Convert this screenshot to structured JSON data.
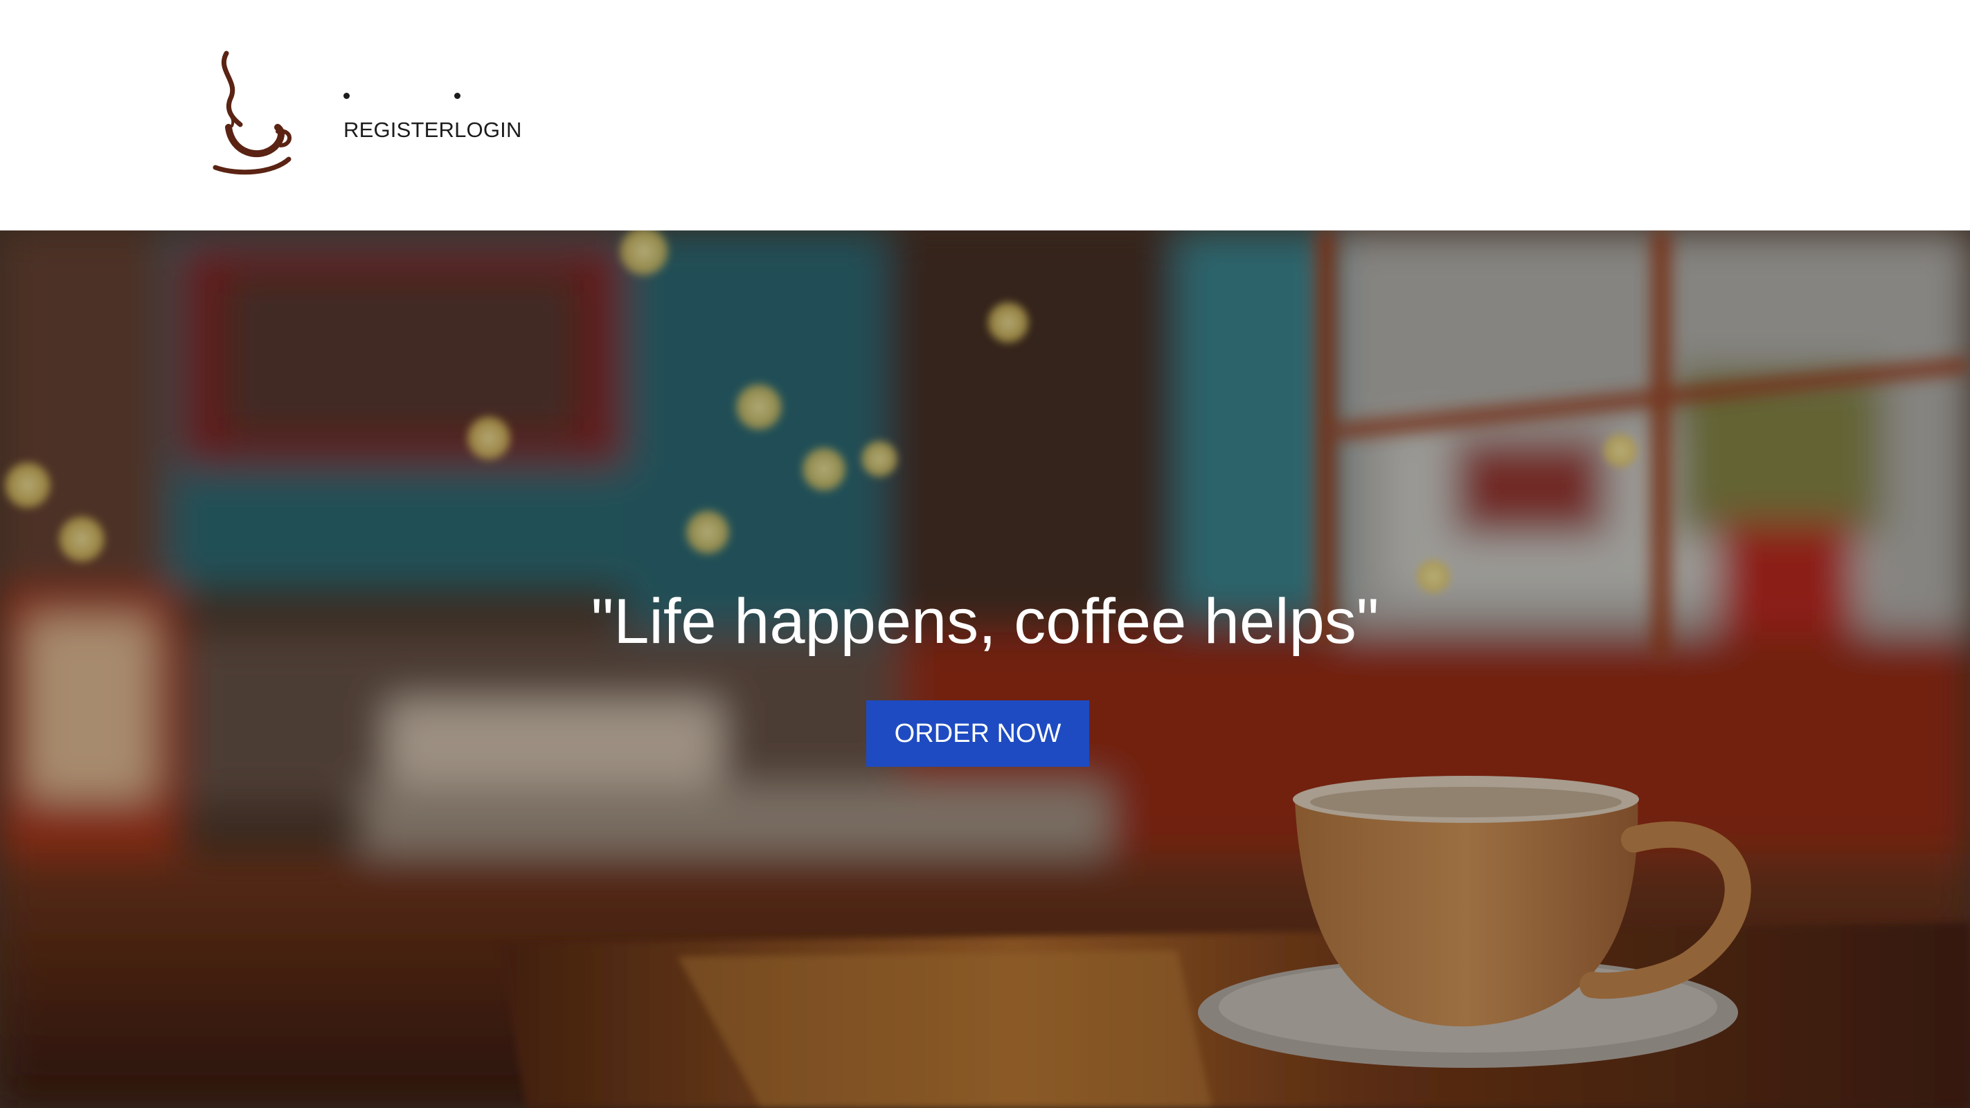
{
  "header": {
    "logo_icon": "coffee-cup-steam-icon",
    "logo_color": "#5a2313",
    "nav": [
      {
        "label": "REGISTER"
      },
      {
        "label": "LOGIN"
      }
    ]
  },
  "hero": {
    "background": "blurred-coffee-shop-interior-with-cup",
    "quote": "\"Life happens, coffee helps\"",
    "cta_label": "ORDER NOW",
    "cta_color": "#1e4bc1"
  }
}
